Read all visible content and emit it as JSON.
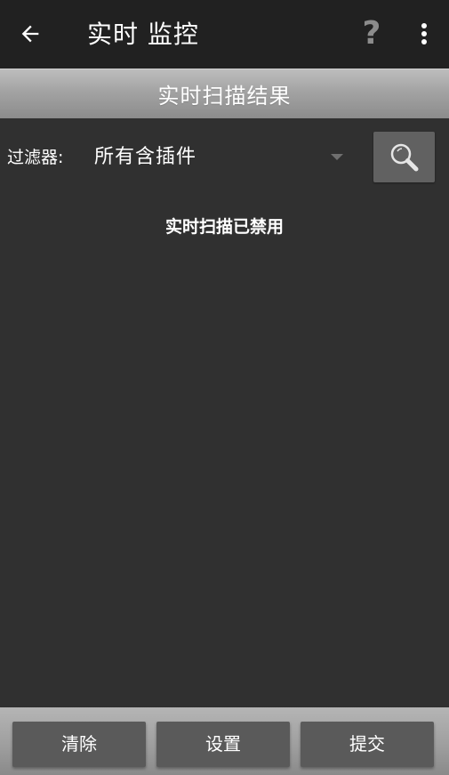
{
  "app_bar": {
    "title": "实时 监控",
    "help_label": "?",
    "back_icon": "arrow-left-icon",
    "more_icon": "more-vert-icon"
  },
  "section": {
    "title": "实时扫描结果"
  },
  "filter": {
    "label": "过滤器:",
    "selected_value": "所有含插件",
    "search_icon": "magnifier-icon"
  },
  "status": {
    "message": "实时扫描已禁用"
  },
  "actions": {
    "clear": "清除",
    "settings": "设置",
    "submit": "提交"
  },
  "colors": {
    "app_bar_bg": "#212121",
    "content_bg": "#303030",
    "button_bg": "#5a5a5a",
    "header_gradient_top": "#bdbdbd",
    "header_gradient_bottom": "#8c8c8c"
  }
}
